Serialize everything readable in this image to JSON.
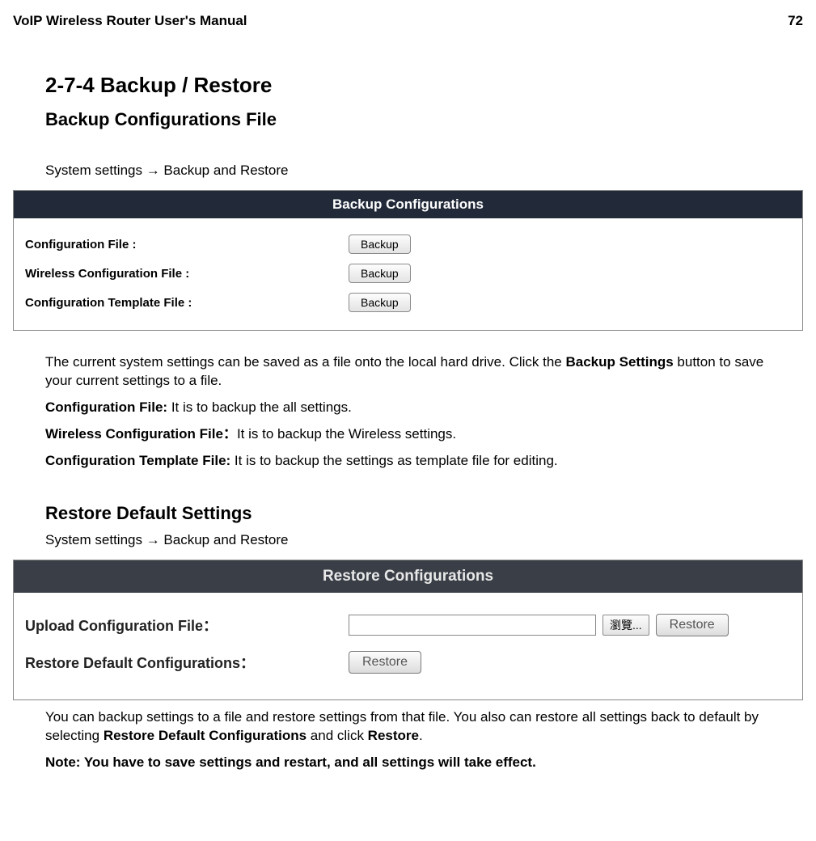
{
  "header": {
    "left": "VoIP Wireless Router User's Manual",
    "right": "72"
  },
  "section": {
    "h1": "2-7-4 Backup / Restore",
    "h2": "Backup Configurations File",
    "path": "System settings  →    Backup and Restore"
  },
  "backup_panel": {
    "title": "Backup Configurations",
    "rows": [
      {
        "label": "Configuration File :",
        "button": "Backup"
      },
      {
        "label": "Wireless Configuration File :",
        "button": "Backup"
      },
      {
        "label": "Configuration Template File :",
        "button": "Backup"
      }
    ]
  },
  "para1_pre": "The current system settings can be saved as a file onto the local hard drive. Click the ",
  "para1_bold": "Backup Settings",
  "para1_post": " button to save your current settings to a file.",
  "para2_bold": "Configuration File:",
  "para2_rest": " It is to backup the all settings.",
  "para3_bold": "Wireless Configuration File：",
  "para3_rest": "It is to backup the Wireless settings.",
  "para4_bold": "Configuration Template File:",
  "para4_rest": " It is to backup the settings as template file for editing.",
  "restore_heading": "Restore Default Settings",
  "restore_path": "System settings  →    Backup and Restore",
  "restore_panel": {
    "title": "Restore Configurations",
    "row1_label": "Upload Configuration File：",
    "row1_browse": "瀏覽...",
    "row1_button": "Restore",
    "row2_label": "Restore Default Configurations：",
    "row2_button": "Restore"
  },
  "para5_pre": "You can backup settings to a file and restore settings from that file. You also can restore all settings back to default by selecting ",
  "para5_bold1": "Restore Default Configurations",
  "para5_mid": " and click ",
  "para5_bold2": "Restore",
  "para5_post": ".",
  "para6": "Note: You have to save settings and restart, and all settings will take effect."
}
